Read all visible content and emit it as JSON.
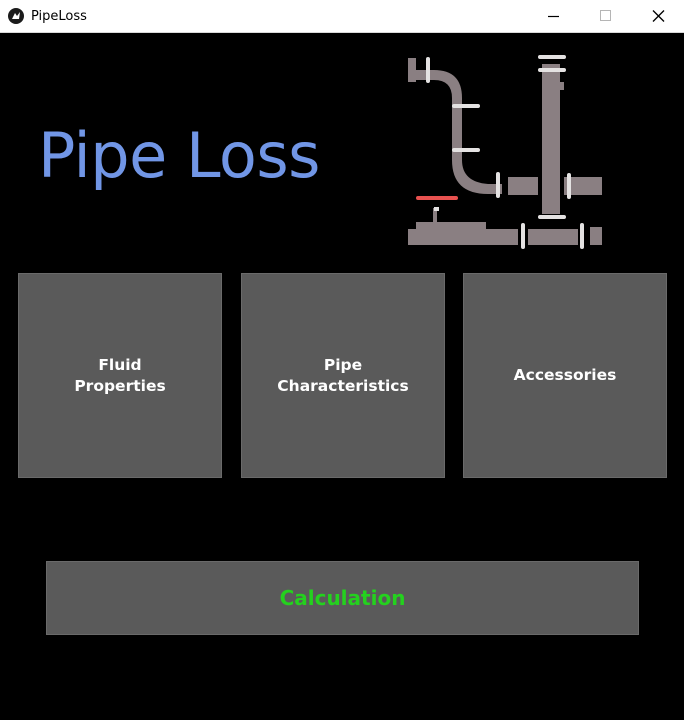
{
  "window": {
    "title": "PipeLoss",
    "icon": "kivy-logo-icon",
    "controls": [
      "minimize-icon",
      "maximize-icon",
      "close-icon"
    ]
  },
  "main": {
    "heading": "Pipe Loss",
    "illustration": "pipes-illustration",
    "tiles": [
      {
        "label": "Fluid\nProperties"
      },
      {
        "label": "Pipe\nCharacteristics"
      },
      {
        "label": "Accessories"
      }
    ],
    "calculation_label": "Calculation"
  },
  "colors": {
    "background": "#000000",
    "heading": "#7196e6",
    "tile": "#5a5a5a",
    "tile_text": "#ffffff",
    "calculation_text": "#24d11e",
    "pipe": "#8a7f82",
    "valve": "#e8514f"
  }
}
